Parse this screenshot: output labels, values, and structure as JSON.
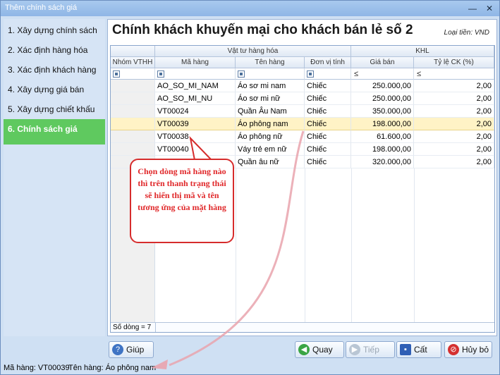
{
  "window": {
    "title": "Thêm chính sách giá",
    "minimize": "—",
    "close": "✕"
  },
  "sidebar": {
    "items": [
      {
        "label": "1. Xây dựng chính sách"
      },
      {
        "label": "2. Xác định hàng hóa"
      },
      {
        "label": "3. Xác định khách hàng"
      },
      {
        "label": "4. Xây dựng giá bán"
      },
      {
        "label": "5. Xây dựng chiết khấu"
      },
      {
        "label": "6. Chính sách giá"
      }
    ]
  },
  "main": {
    "heading": "Chính khách khuyến mại cho khách bán lẻ số 2",
    "currency": "Loại tiền: VND"
  },
  "grid": {
    "band_headers": {
      "goods": "Vật tư hàng hóa",
      "khl": "KHL"
    },
    "columns": [
      "Nhóm VTHH",
      "Mã hàng",
      "Tên hàng",
      "Đơn vị tính",
      "Giá bán",
      "Tỷ lệ CK (%)"
    ],
    "filters": {
      "price_op": "≤",
      "ratio_op": "≤"
    },
    "rows": [
      {
        "group": "",
        "code": "AO_SO_MI_NAM",
        "name": "Áo sơ mi nam",
        "unit": "Chiếc",
        "price": "250.000,00",
        "ratio": "2,00"
      },
      {
        "group": "",
        "code": "AO_SO_MI_NU",
        "name": "Áo sơ mi nữ",
        "unit": "Chiếc",
        "price": "250.000,00",
        "ratio": "2,00"
      },
      {
        "group": "",
        "code": "VT00024",
        "name": "Quần Âu Nam",
        "unit": "Chiếc",
        "price": "350.000,00",
        "ratio": "2,00"
      },
      {
        "group": "",
        "code": "VT00039",
        "name": "Áo phông nam",
        "unit": "Chiếc",
        "price": "198.000,00",
        "ratio": "2,00"
      },
      {
        "group": "",
        "code": "VT00038",
        "name": "Áo phông nữ",
        "unit": "Chiếc",
        "price": "61.600,00",
        "ratio": "2,00"
      },
      {
        "group": "",
        "code": "VT00040",
        "name": "Váy trẻ em nữ",
        "unit": "Chiếc",
        "price": "198.000,00",
        "ratio": "2,00"
      },
      {
        "group": "",
        "code": "",
        "name": "Quần âu nữ",
        "unit": "Chiếc",
        "price": "320.000,00",
        "ratio": "2,00"
      }
    ],
    "row_count": "Số dòng = 7"
  },
  "buttons": {
    "help": "Giúp",
    "back": "Quay lại",
    "next": "Tiếp theo",
    "save": "Cất",
    "cancel": "Hủy bỏ"
  },
  "statusbar": {
    "code": "Mã hàng: VT00039",
    "name": "Tên hàng: Áo phông nam"
  },
  "callout": {
    "text": "Chọn dòng mã hàng nào thì trên thanh trạng thái sẽ hiển thị mã và tên tương ứng của mặt hàng"
  }
}
